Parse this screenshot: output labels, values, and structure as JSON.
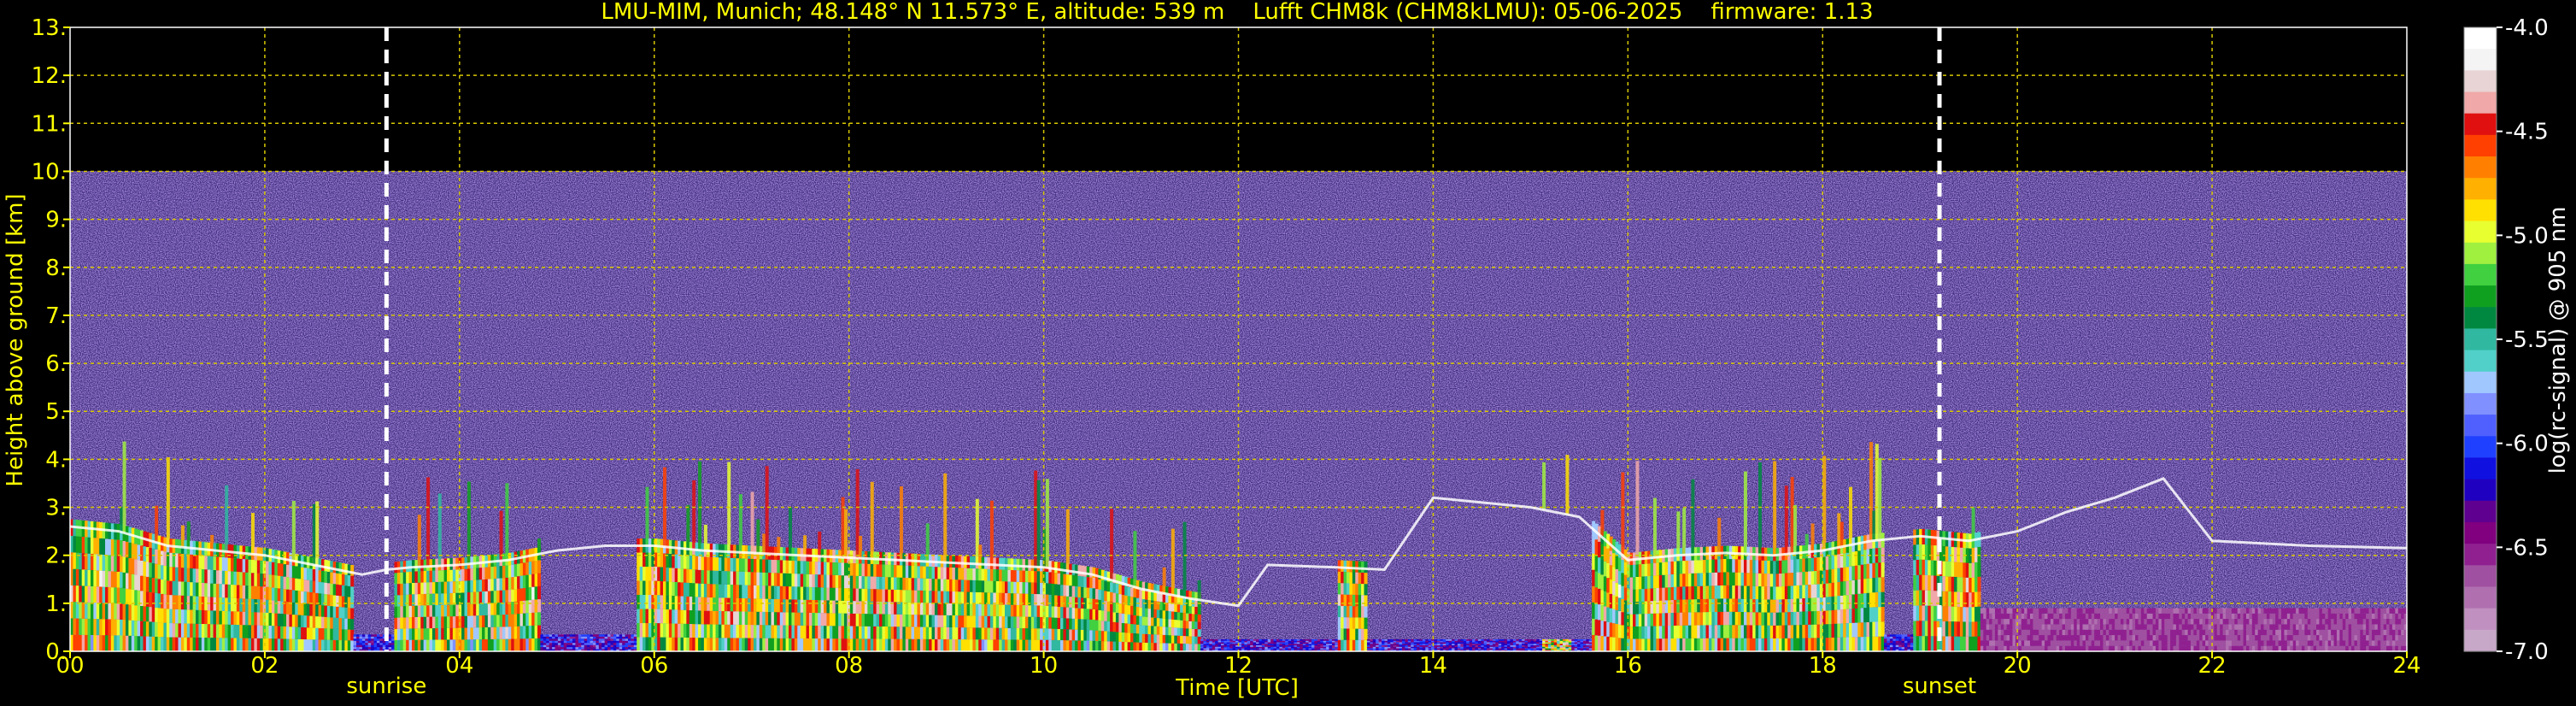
{
  "chart_data": {
    "type": "heatmap",
    "title": "LMU-MIM, Munich; 48.148° N 11.573° E, altitude: 539 m    Lufft CHM8k (CHM8kLMU): 05-06-2025    firmware: 1.13",
    "xlabel": "Time [UTC]",
    "ylabel": "Height above ground [km]",
    "xlim": [
      0,
      24
    ],
    "ylim": [
      0,
      13
    ],
    "x_ticks": [
      {
        "v": 0,
        "label": "00"
      },
      {
        "v": 2,
        "label": "02"
      },
      {
        "v": 4,
        "label": "04"
      },
      {
        "v": 6,
        "label": "06"
      },
      {
        "v": 8,
        "label": "08"
      },
      {
        "v": 10,
        "label": "10"
      },
      {
        "v": 12,
        "label": "12"
      },
      {
        "v": 14,
        "label": "14"
      },
      {
        "v": 16,
        "label": "16"
      },
      {
        "v": 18,
        "label": "18"
      },
      {
        "v": 20,
        "label": "20"
      },
      {
        "v": 22,
        "label": "22"
      },
      {
        "v": 24,
        "label": "24"
      }
    ],
    "y_ticks": [
      {
        "v": 0,
        "label": "0."
      },
      {
        "v": 1,
        "label": "1."
      },
      {
        "v": 2,
        "label": "2."
      },
      {
        "v": 3,
        "label": "3."
      },
      {
        "v": 4,
        "label": "4."
      },
      {
        "v": 5,
        "label": "5."
      },
      {
        "v": 6,
        "label": "6."
      },
      {
        "v": 7,
        "label": "7."
      },
      {
        "v": 8,
        "label": "8."
      },
      {
        "v": 9,
        "label": "9."
      },
      {
        "v": 10,
        "label": "10."
      },
      {
        "v": 11,
        "label": "11."
      },
      {
        "v": 12,
        "label": "12."
      },
      {
        "v": 13,
        "label": "13."
      }
    ],
    "grid": true,
    "signal_top_km": 10,
    "events": [
      {
        "label": "sunrise",
        "time_utc": 3.25
      },
      {
        "label": "sunset",
        "time_utc": 19.2
      }
    ],
    "cloud_base_km": [
      [
        0.0,
        2.6
      ],
      [
        0.5,
        2.5
      ],
      [
        1.0,
        2.2
      ],
      [
        1.5,
        2.1
      ],
      [
        2.0,
        2.0
      ],
      [
        2.5,
        1.8
      ],
      [
        3.0,
        1.6
      ],
      [
        3.25,
        1.7
      ],
      [
        3.5,
        1.75
      ],
      [
        4.0,
        1.8
      ],
      [
        4.5,
        1.9
      ],
      [
        5.0,
        2.1
      ],
      [
        5.5,
        2.2
      ],
      [
        6.0,
        2.2
      ],
      [
        6.5,
        2.1
      ],
      [
        7.0,
        2.05
      ],
      [
        7.5,
        2.0
      ],
      [
        8.0,
        1.95
      ],
      [
        8.5,
        1.9
      ],
      [
        9.0,
        1.85
      ],
      [
        9.5,
        1.8
      ],
      [
        10.0,
        1.75
      ],
      [
        10.5,
        1.6
      ],
      [
        11.0,
        1.3
      ],
      [
        11.5,
        1.1
      ],
      [
        12.0,
        0.95
      ],
      [
        12.3,
        1.8
      ],
      [
        13.0,
        1.75
      ],
      [
        13.5,
        1.7
      ],
      [
        14.0,
        3.2
      ],
      [
        14.5,
        3.1
      ],
      [
        15.0,
        3.0
      ],
      [
        15.5,
        2.8
      ],
      [
        16.0,
        1.9
      ],
      [
        16.5,
        2.0
      ],
      [
        17.0,
        2.05
      ],
      [
        17.5,
        2.0
      ],
      [
        18.0,
        2.1
      ],
      [
        18.5,
        2.3
      ],
      [
        19.0,
        2.4
      ],
      [
        19.5,
        2.3
      ],
      [
        20.0,
        2.5
      ],
      [
        20.5,
        2.9
      ],
      [
        21.0,
        3.2
      ],
      [
        21.5,
        3.6
      ],
      [
        22.0,
        2.3
      ],
      [
        23.0,
        2.2
      ],
      [
        24.0,
        2.15
      ]
    ],
    "colorbar": {
      "label": "log(rc-signal) @ 905 nm",
      "vmin": -7.0,
      "vmax": -4.0,
      "ticks": [
        {
          "v": -4.0,
          "label": "-4.0"
        },
        {
          "v": -4.5,
          "label": "-4.5"
        },
        {
          "v": -5.0,
          "label": "-5.0"
        },
        {
          "v": -5.5,
          "label": "-5.5"
        },
        {
          "v": -6.0,
          "label": "-6.0"
        },
        {
          "v": -6.5,
          "label": "-6.5"
        },
        {
          "v": -7.0,
          "label": "-7.0"
        }
      ],
      "colors_top_to_bottom": [
        "#ffffff",
        "#f4f4f4",
        "#e8d4d4",
        "#f0a8a8",
        "#e01010",
        "#ff4000",
        "#ff8000",
        "#ffb000",
        "#ffe000",
        "#e8ff30",
        "#a0f040",
        "#40d040",
        "#10a020",
        "#008840",
        "#30b8a0",
        "#50d0c8",
        "#a0c8ff",
        "#8090ff",
        "#5060ff",
        "#2040ff",
        "#1010e0",
        "#2000c0",
        "#600090",
        "#800080",
        "#902090",
        "#a050a0",
        "#b070b0",
        "#c090c0",
        "#c8a8c8"
      ]
    }
  }
}
